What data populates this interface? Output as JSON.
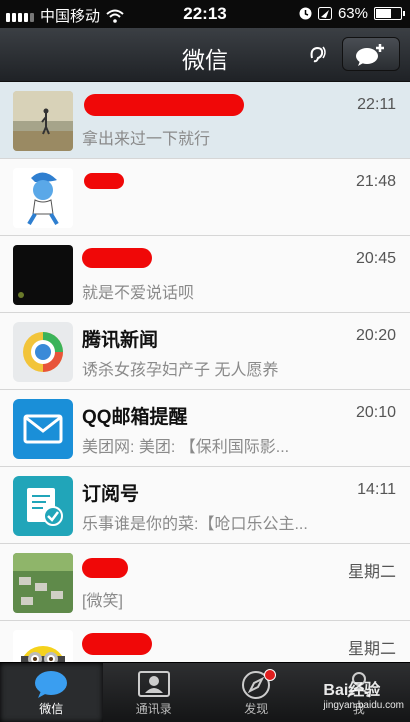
{
  "status_bar": {
    "carrier": "中国移动",
    "time": "22:13",
    "battery": "63%",
    "battery_level": 0.63
  },
  "nav": {
    "title": "微信"
  },
  "chats": [
    {
      "name": "",
      "time": "22:11",
      "preview": "拿出来过一下就行"
    },
    {
      "name": "",
      "time": "21:48",
      "preview": ""
    },
    {
      "name": "",
      "time": "20:45",
      "preview": "就是不爱说话呗"
    },
    {
      "name": "腾讯新闻",
      "time": "20:20",
      "preview": "诱杀女孩孕妇产子 无人愿养"
    },
    {
      "name": "QQ邮箱提醒",
      "time": "20:10",
      "preview": "美团网: 美团: 【保利国际影..."
    },
    {
      "name": "订阅号",
      "time": "14:11",
      "preview": "乐事谁是你的菜:【呛口乐公主..."
    },
    {
      "name": "",
      "time": "星期二",
      "preview": "[微笑]"
    },
    {
      "name": "",
      "time": "星期二",
      "preview": ""
    }
  ],
  "tabs": [
    {
      "label": "微信",
      "icon": "chat-bubble-icon"
    },
    {
      "label": "通讯录",
      "icon": "contacts-icon"
    },
    {
      "label": "发现",
      "icon": "compass-icon"
    },
    {
      "label": "我",
      "icon": "person-icon"
    }
  ],
  "watermark": {
    "brand": "Bai经验",
    "url": "jingyan.baidu.com"
  },
  "colors": {
    "redaction": "#f00808",
    "badge": "#e01e1e",
    "mail_blue": "#1a8fd8",
    "subscription_teal": "#21a5b9"
  }
}
